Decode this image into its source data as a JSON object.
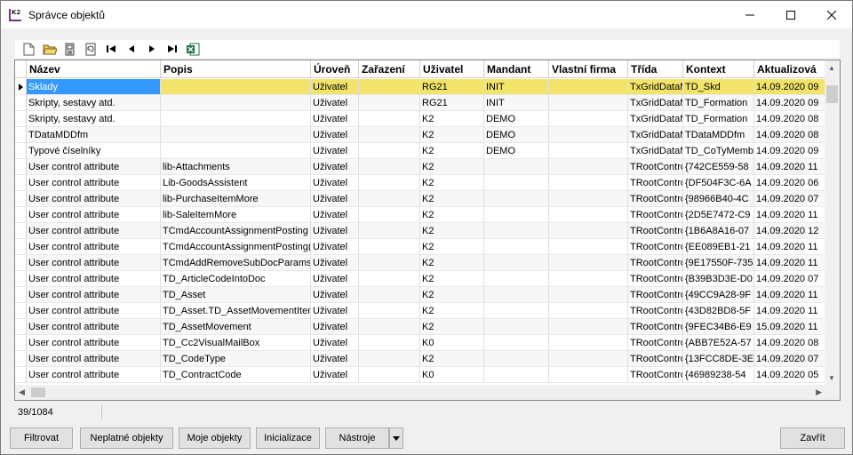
{
  "window": {
    "title": "Správce objektů",
    "app_icon": "k2-app-icon"
  },
  "toolbar": {
    "icons": [
      "new-icon",
      "open-icon",
      "save-icon",
      "refresh-icon",
      "first-icon",
      "prev-icon",
      "next-icon",
      "last-icon",
      "excel-icon"
    ]
  },
  "grid": {
    "columns": [
      "Název",
      "Popis",
      "Úroveň",
      "Zařazení",
      "Uživatel",
      "Mandant",
      "Vlastní firma",
      "Třída",
      "Kontext",
      "Aktualizová"
    ],
    "rows": [
      [
        "Sklady",
        "",
        "Uživatel",
        "",
        "RG21",
        "INIT",
        "",
        "TxGridDataM",
        "TD_Skd",
        "14.09.2020 09"
      ],
      [
        "Skripty, sestavy atd.",
        "",
        "Uživatel",
        "",
        "RG21",
        "INIT",
        "",
        "TxGridDataM",
        "TD_Formation",
        "14.09.2020 09"
      ],
      [
        "Skripty, sestavy atd.",
        "",
        "Uživatel",
        "",
        "K2",
        "DEMO",
        "",
        "TxGridDataM",
        "TD_Formation",
        "14.09.2020 08"
      ],
      [
        "TDataMDDfm",
        "",
        "Uživatel",
        "",
        "K2",
        "DEMO",
        "",
        "TxGridDataM",
        "TDataMDDfm",
        "14.09.2020 08"
      ],
      [
        "Typové číselníky",
        "",
        "Uživatel",
        "",
        "K2",
        "DEMO",
        "",
        "TxGridDataM",
        "TD_CoTyMemb",
        "14.09.2020 09"
      ],
      [
        "User control attribute",
        "lib-Attachments",
        "Uživatel",
        "",
        "K2",
        "",
        "",
        "TRootContro",
        "{742CE559-58",
        "14.09.2020 11"
      ],
      [
        "User control attribute",
        "Lib-GoodsAssistent",
        "Uživatel",
        "",
        "K2",
        "",
        "",
        "TRootContro",
        "{DF504F3C-6A",
        "14.09.2020 06"
      ],
      [
        "User control attribute",
        "lib-PurchaseItemMore",
        "Uživatel",
        "",
        "K2",
        "",
        "",
        "TRootContro",
        "{98966B40-4C",
        "14.09.2020 07"
      ],
      [
        "User control attribute",
        "lib-SaleItemMore",
        "Uživatel",
        "",
        "K2",
        "",
        "",
        "TRootContro",
        "{2D5E7472-C9",
        "14.09.2020 11"
      ],
      [
        "User control attribute",
        "TCmdAccountAssignmentPosting",
        "Uživatel",
        "",
        "K2",
        "",
        "",
        "TRootContro",
        "{1B6A8A16-07",
        "14.09.2020 12"
      ],
      [
        "User control attribute",
        "TCmdAccountAssignmentPosting(P",
        "Uživatel",
        "",
        "K2",
        "",
        "",
        "TRootContro",
        "{EE089EB1-21",
        "14.09.2020 11"
      ],
      [
        "User control attribute",
        "TCmdAddRemoveSubDocParams(S",
        "Uživatel",
        "",
        "K2",
        "",
        "",
        "TRootContro",
        "{9E17550F-735",
        "14.09.2020 11"
      ],
      [
        "User control attribute",
        "TD_ArticleCodeIntoDoc",
        "Uživatel",
        "",
        "K2",
        "",
        "",
        "TRootContro",
        "{B39B3D3E-D0",
        "14.09.2020 07"
      ],
      [
        "User control attribute",
        "TD_Asset",
        "Uživatel",
        "",
        "K2",
        "",
        "",
        "TRootContro",
        "{49CC9A28-9F",
        "14.09.2020 11"
      ],
      [
        "User control attribute",
        "TD_Asset.TD_AssetMovementItem",
        "Uživatel",
        "",
        "K2",
        "",
        "",
        "TRootContro",
        "{43D82BD8-5F",
        "14.09.2020 11"
      ],
      [
        "User control attribute",
        "TD_AssetMovement",
        "Uživatel",
        "",
        "K2",
        "",
        "",
        "TRootContro",
        "{9FEC34B6-E9",
        "15.09.2020 11"
      ],
      [
        "User control attribute",
        "TD_Cc2VisualMailBox",
        "Uživatel",
        "",
        "K0",
        "",
        "",
        "TRootContro",
        "{ABB7E52A-57",
        "14.09.2020 08"
      ],
      [
        "User control attribute",
        "TD_CodeType",
        "Uživatel",
        "",
        "K2",
        "",
        "",
        "TRootContro",
        "{13FCC8DE-3E",
        "14.09.2020 07"
      ],
      [
        "User control attribute",
        "TD_ContractCode",
        "Uživatel",
        "",
        "K0",
        "",
        "",
        "TRootContro",
        "{46989238-54",
        "14.09.2020 05"
      ]
    ]
  },
  "status": {
    "count": "39/1084"
  },
  "buttons": {
    "filter": "Filtrovat",
    "invalid": "Neplatné objekty",
    "mine": "Moje objekty",
    "init": "Inicializace",
    "tools": "Nástroje",
    "close": "Zavřít"
  }
}
